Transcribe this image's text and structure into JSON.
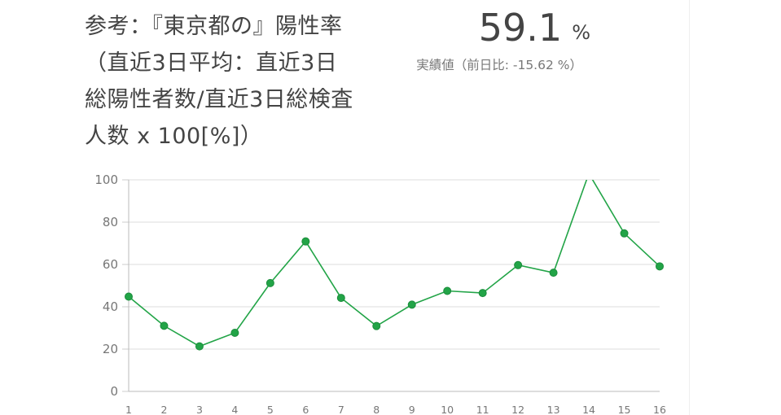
{
  "header": {
    "title_lines": [
      "参考：『東京都の』陽性率",
      "（直近3日平均：直近3日",
      "総陽性者数/直近3日総検査",
      "人数 x 100[%]）"
    ],
    "value": "59.1",
    "unit": "%",
    "sub_label": "実績値（前日比: -15.62 %）"
  },
  "colors": {
    "series": "#22a447",
    "grid": "#dddddd",
    "axis": "#999999",
    "text": "#444444"
  },
  "chart_data": {
    "type": "line",
    "title": "",
    "xlabel": "",
    "ylabel": "",
    "ylim": [
      0,
      100
    ],
    "yticks": [
      0,
      20,
      40,
      60,
      80,
      100
    ],
    "grid": true,
    "categories": [
      "1",
      "2",
      "3",
      "4",
      "5",
      "6",
      "7",
      "8",
      "9",
      "10",
      "11",
      "12",
      "13",
      "14",
      "15",
      "16"
    ],
    "series": [
      {
        "values": [
          44.8,
          31.0,
          21.3,
          27.7,
          51.2,
          70.9,
          44.2,
          30.9,
          41.0,
          47.5,
          46.5,
          59.7,
          56.1,
          103.0,
          74.7,
          59.1
        ]
      }
    ]
  }
}
